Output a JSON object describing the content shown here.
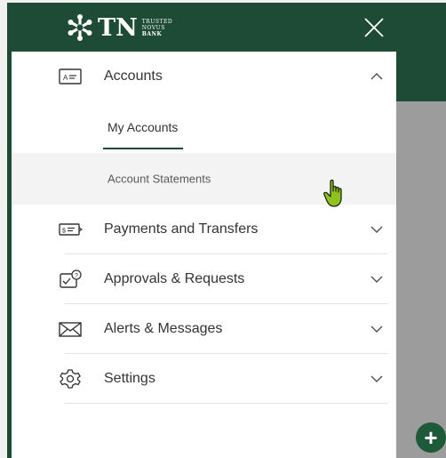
{
  "brand": {
    "name": "TN",
    "tagline": [
      "TRUSTED",
      "NOVUS",
      "BANK"
    ]
  },
  "menu": {
    "accounts": {
      "label": "Accounts",
      "icon": "account-card-icon",
      "expanded": true,
      "subitems": [
        {
          "label": "My Accounts",
          "active": true
        },
        {
          "label": "Account Statements",
          "hovered": true
        }
      ]
    },
    "items": [
      {
        "label": "Payments and Transfers",
        "icon": "payment-card-icon"
      },
      {
        "label": "Approvals & Requests",
        "icon": "approval-icon"
      },
      {
        "label": "Alerts & Messages",
        "icon": "envelope-icon"
      },
      {
        "label": "Settings",
        "icon": "gear-icon"
      }
    ]
  },
  "colors": {
    "brand_green": "#1e4b36",
    "accent_green": "#1d5a3a"
  }
}
